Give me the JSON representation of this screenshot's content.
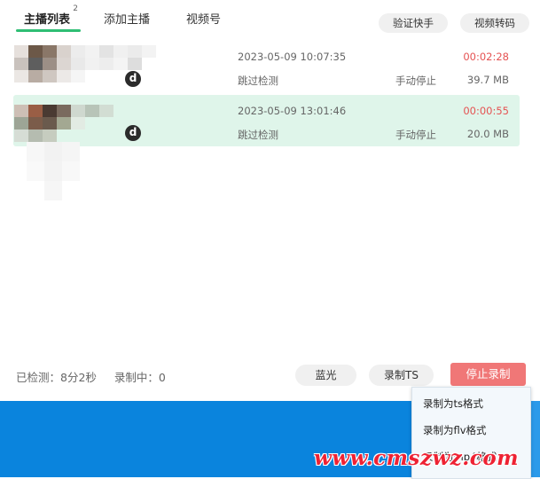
{
  "tabs": [
    {
      "label": "主播列表",
      "badge": "2",
      "active": true
    },
    {
      "label": "添加主播",
      "active": false
    },
    {
      "label": "视频号",
      "active": false
    }
  ],
  "top_buttons": {
    "verify": "验证快手",
    "convert": "视频转码"
  },
  "recordings": [
    {
      "avatar_letter": "d",
      "datetime": "2023-05-09 10:07:35",
      "skip_label": "跳过检测",
      "stop_mode": "手动停止",
      "duration": "00:02:28",
      "size": "39.7 MB",
      "selected": false
    },
    {
      "avatar_letter": "d",
      "datetime": "2023-05-09 13:01:46",
      "skip_label": "跳过检测",
      "stop_mode": "手动停止",
      "duration": "00:00:55",
      "size": "20.0 MB",
      "selected": true
    }
  ],
  "status": {
    "checked": "已检测：8分2秒",
    "recording": "录制中：0"
  },
  "bottom_buttons": {
    "bluray": "蓝光",
    "record_ts": "录制TS",
    "stop_record": "停止录制"
  },
  "format_menu": {
    "items": [
      "录制为ts格式",
      "录制为flv格式",
      "录制为mp4格式"
    ]
  },
  "watermark": "www.cmszwz.com",
  "colors": {
    "accent_green": "#2fbe74",
    "selected_row": "#dff5ea",
    "duration_red": "#e55353",
    "stop_button": "#f07777",
    "desktop_blue": "#0a84dd"
  }
}
